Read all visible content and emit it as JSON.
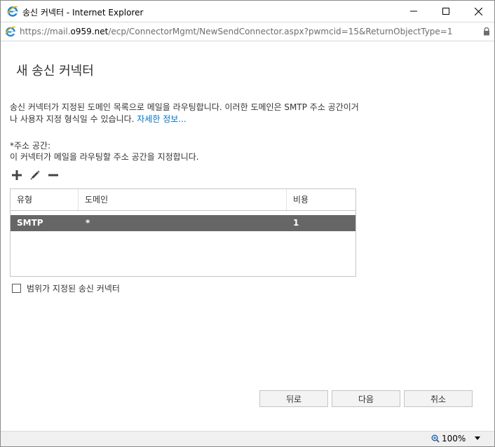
{
  "window": {
    "title": "송신 커넥터 - Internet Explorer",
    "url_prefix": "https://mail.",
    "url_host": "o959.net",
    "url_path": "/ecp/ConnectorMgmt/NewSendConnector.aspx?pwmcid=15&ReturnObjectType=1"
  },
  "page": {
    "title": "새 송신 커넥터",
    "description": "송신 커넥터가 지정된 도메인 목록으로 메일을 라우팅합니다. 이러한 도메인은 SMTP 주소 공간이거나 사용자 지정 형식일 수 있습니다. ",
    "learn_more": "자세한 정보...",
    "address_space_label": "*주소 공간:",
    "address_space_help": "이 커넥터가 메일을 라우팅할 주소 공간을 지정합니다."
  },
  "grid": {
    "columns": [
      "유형",
      "도메인",
      "비용"
    ],
    "rows": [
      {
        "type": "SMTP",
        "domain": "*",
        "cost": "1"
      }
    ]
  },
  "scoped": {
    "label": "범위가 지정된 송신 커넥터"
  },
  "buttons": {
    "back": "뒤로",
    "next": "다음",
    "cancel": "취소"
  },
  "status": {
    "zoom": "100%"
  },
  "colors": {
    "selected_row": "#666666",
    "link": "#0072c6",
    "ie_blue": "#1e88d8"
  }
}
